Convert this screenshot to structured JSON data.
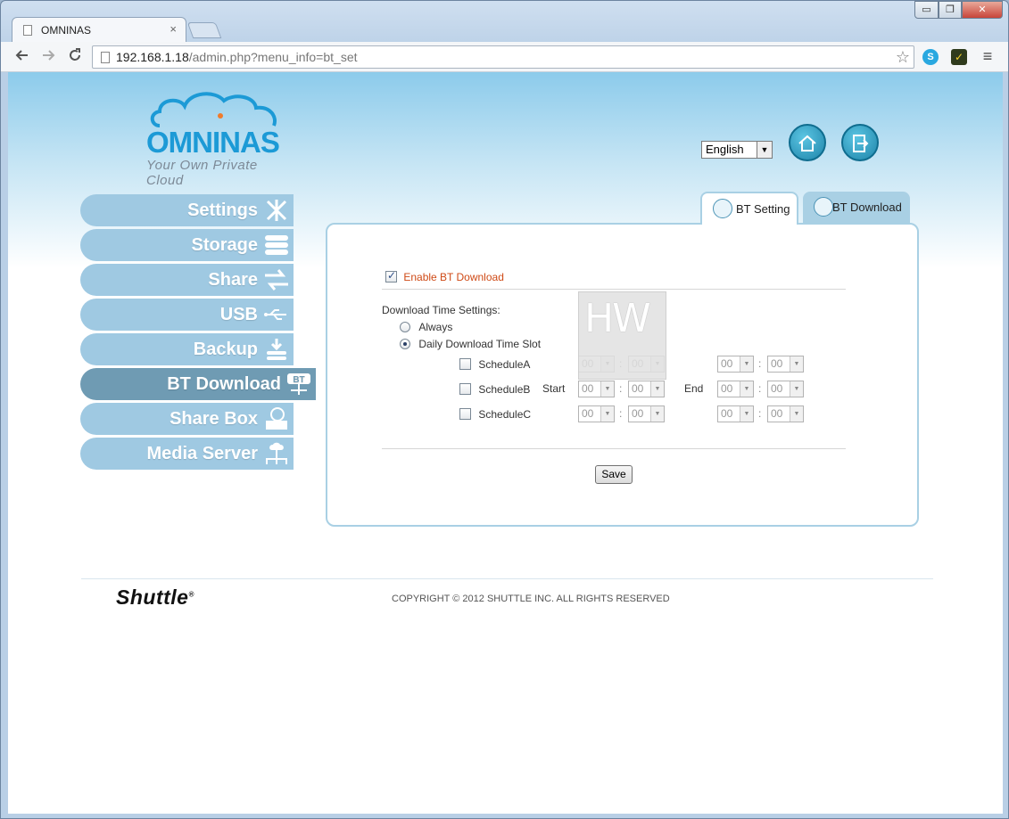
{
  "browser": {
    "tab_title": "OMNINAS",
    "tab_close": "×",
    "url_host": "192.168.1.18",
    "url_path": "/admin.php?menu_info=bt_set",
    "win_min": "▭",
    "win_max": "❐",
    "win_close": "✕",
    "skype_label": "S",
    "norton_label": "✓"
  },
  "header": {
    "logo_word": "OMNINAS",
    "logo_tagline": "Your Own Private Cloud",
    "language": "English"
  },
  "sidebar": {
    "items": [
      {
        "label": "Settings",
        "icon": "tools-icon"
      },
      {
        "label": "Storage",
        "icon": "storage-icon"
      },
      {
        "label": "Share",
        "icon": "share-arrows-icon"
      },
      {
        "label": "USB",
        "icon": "usb-icon"
      },
      {
        "label": "Backup",
        "icon": "backup-icon"
      },
      {
        "label": "BT Download",
        "icon": "bt-icon",
        "active": true
      },
      {
        "label": "Share Box",
        "icon": "share-box-icon"
      },
      {
        "label": "Media Server",
        "icon": "media-server-icon"
      }
    ]
  },
  "tabs": {
    "bt_setting": "BT Setting",
    "bt_download": "BT Download",
    "bt_icon_text": "BT"
  },
  "form": {
    "enable_label": "Enable BT Download",
    "enabled": true,
    "time_settings_label": "Download Time Settings:",
    "always_label": "Always",
    "daily_label": "Daily Download Time Slot",
    "mode": "daily",
    "start_label": "Start",
    "end_label": "End",
    "colon": ":",
    "schedules": [
      {
        "label": "ScheduleA",
        "start_h": "00",
        "start_m": "00",
        "end_h": "00",
        "end_m": "00"
      },
      {
        "label": "ScheduleB",
        "start_h": "00",
        "start_m": "00",
        "end_h": "00",
        "end_m": "00"
      },
      {
        "label": "ScheduleC",
        "start_h": "00",
        "start_m": "00",
        "end_h": "00",
        "end_m": "00"
      }
    ],
    "save_label": "Save",
    "overlay_text": "HW"
  },
  "footer": {
    "brand": "Shuttle",
    "brand_mark": "®",
    "copyright": "COPYRIGHT © 2012 SHUTTLE INC. ALL RIGHTS RESERVED"
  },
  "colors": {
    "sidebar_item": "#9fc9e2",
    "sidebar_active": "#6f9bb3",
    "accent_orange": "#cf4a16",
    "logo_blue": "#1c9ad6"
  }
}
